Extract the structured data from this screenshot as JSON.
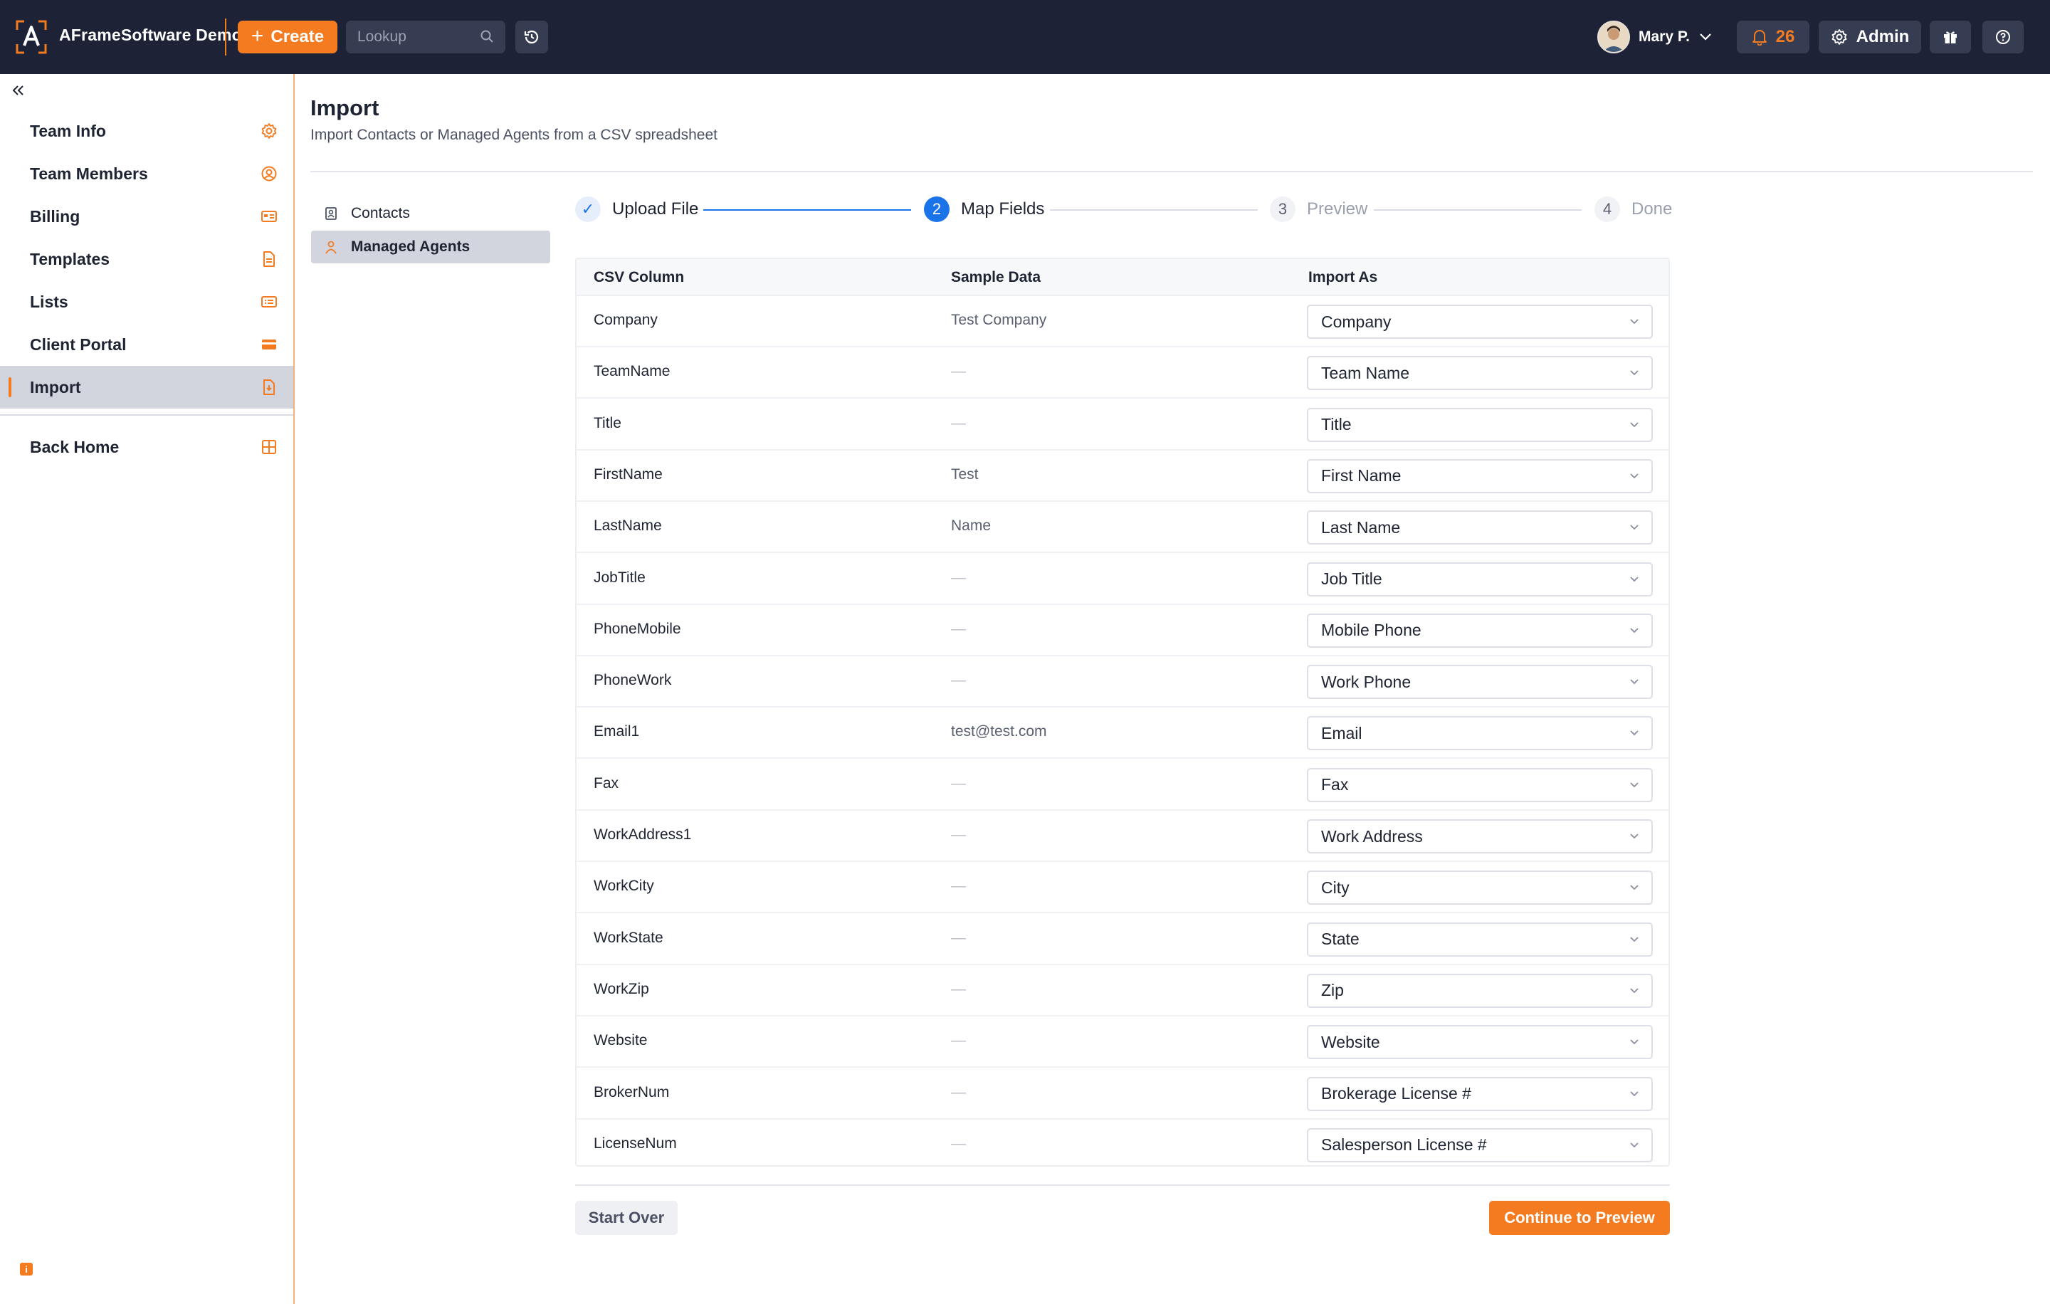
{
  "topbar": {
    "brand": "AFrameSoftware Demo",
    "create_label": "Create",
    "lookup_placeholder": "Lookup",
    "user_name": "Mary P.",
    "notification_count": "26",
    "admin_label": "Admin",
    "accent_color": "#f47b20",
    "bg_color": "#1d2236"
  },
  "sidebar": {
    "items": [
      {
        "label": "Team Info",
        "icon": "gear-icon"
      },
      {
        "label": "Team Members",
        "icon": "user-circle-icon"
      },
      {
        "label": "Billing",
        "icon": "billing-card-icon"
      },
      {
        "label": "Templates",
        "icon": "document-icon"
      },
      {
        "label": "Lists",
        "icon": "list-card-icon"
      },
      {
        "label": "Client Portal",
        "icon": "credit-card-icon"
      },
      {
        "label": "Import",
        "icon": "import-document-icon",
        "active": true
      }
    ],
    "back_home": {
      "label": "Back Home",
      "icon": "grid-icon"
    },
    "info_icon": "info-icon"
  },
  "page": {
    "title": "Import",
    "subtitle": "Import Contacts or Managed Agents from a CSV spreadsheet"
  },
  "subnav": {
    "items": [
      {
        "label": "Contacts",
        "icon": "contact-book-icon",
        "active": false
      },
      {
        "label": "Managed Agents",
        "icon": "agent-person-icon",
        "active": true
      }
    ]
  },
  "stepper": {
    "steps": [
      {
        "num": "✓",
        "label": "Upload File",
        "state": "done"
      },
      {
        "num": "2",
        "label": "Map Fields",
        "state": "current"
      },
      {
        "num": "3",
        "label": "Preview",
        "state": "todo"
      },
      {
        "num": "4",
        "label": "Done",
        "state": "todo"
      }
    ],
    "active_color": "#1a73e8"
  },
  "table": {
    "headers": [
      "CSV Column",
      "Sample Data",
      "Import As"
    ],
    "rows": [
      {
        "column": "Company",
        "sample": "Test Company",
        "import_as": "Company"
      },
      {
        "column": "TeamName",
        "sample": "—",
        "import_as": "Team Name"
      },
      {
        "column": "Title",
        "sample": "—",
        "import_as": "Title"
      },
      {
        "column": "FirstName",
        "sample": "Test",
        "import_as": "First Name"
      },
      {
        "column": "LastName",
        "sample": "Name",
        "import_as": "Last Name"
      },
      {
        "column": "JobTitle",
        "sample": "—",
        "import_as": "Job Title"
      },
      {
        "column": "PhoneMobile",
        "sample": "—",
        "import_as": "Mobile Phone"
      },
      {
        "column": "PhoneWork",
        "sample": "—",
        "import_as": "Work Phone"
      },
      {
        "column": "Email1",
        "sample": "test@test.com",
        "import_as": "Email"
      },
      {
        "column": "Fax",
        "sample": "—",
        "import_as": "Fax"
      },
      {
        "column": "WorkAddress1",
        "sample": "—",
        "import_as": "Work Address"
      },
      {
        "column": "WorkCity",
        "sample": "—",
        "import_as": "City"
      },
      {
        "column": "WorkState",
        "sample": "—",
        "import_as": "State"
      },
      {
        "column": "WorkZip",
        "sample": "—",
        "import_as": "Zip"
      },
      {
        "column": "Website",
        "sample": "—",
        "import_as": "Website"
      },
      {
        "column": "BrokerNum",
        "sample": "—",
        "import_as": "Brokerage License #"
      },
      {
        "column": "LicenseNum",
        "sample": "—",
        "import_as": "Salesperson License #"
      }
    ]
  },
  "actions": {
    "start_over": "Start Over",
    "continue": "Continue to Preview"
  }
}
